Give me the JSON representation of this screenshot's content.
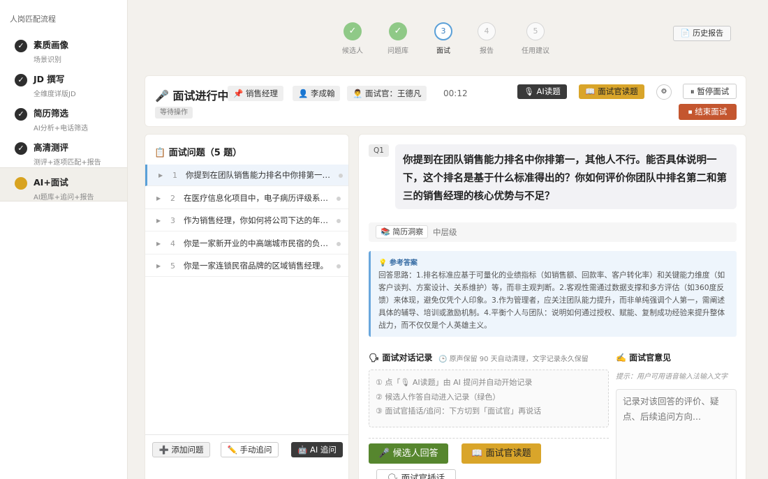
{
  "sidebar": {
    "title": "人岗匹配流程",
    "steps": [
      {
        "title": "素质画像",
        "sub": "场景识别",
        "icon": "check-icon"
      },
      {
        "title": "JD 撰写",
        "sub": "全维度详版JD",
        "icon": "check-icon"
      },
      {
        "title": "简历筛选",
        "sub": "AI分析+电话筛选",
        "icon": "check-icon"
      },
      {
        "title": "高清测评",
        "sub": "测评+逐项匹配+报告",
        "icon": "check-icon"
      },
      {
        "title": "AI+面试",
        "sub": "AI题库+追问+报告",
        "icon": "active-dot"
      }
    ]
  },
  "progress": {
    "steps": [
      {
        "label": "候选人",
        "mark": "✓",
        "state": "done"
      },
      {
        "label": "问题库",
        "mark": "✓",
        "state": "done"
      },
      {
        "label": "面试",
        "mark": "3",
        "state": "current"
      },
      {
        "label": "报告",
        "mark": "4",
        "state": "todo"
      },
      {
        "label": "任用建议",
        "mark": "5",
        "state": "todo"
      }
    ],
    "history_button": "📄 历史报告"
  },
  "header": {
    "title": "🎤 面试进行中",
    "position_tag": "📌 销售经理",
    "candidate_tag": "👤 李成翰",
    "interviewer_tag": "👨‍💼 面试官：王德凡",
    "timer": "00:12",
    "status": "等待操作",
    "ai_read_button": "🎙 AI读题",
    "interviewer_read_button": "📖 面试官读题",
    "settings_icon": "gear-icon",
    "pause_button": "⏸ 暂停面试",
    "end_button": "⏹ 结束面试"
  },
  "question_list": {
    "title": "📋 面试问题（5 题）",
    "items": [
      {
        "num": "1",
        "text": "你提到在团队销售能力排名中你排第一，其他人不行。"
      },
      {
        "num": "2",
        "text": "在医疗信息化项目中，电子病历评级系统的客户是谁？"
      },
      {
        "num": "3",
        "text": "作为销售经理，你如何将公司下达的年度目标分解？"
      },
      {
        "num": "4",
        "text": "你是一家新开业的中高端城市民宿的负责人。"
      },
      {
        "num": "5",
        "text": "你是一家连锁民宿品牌的区域销售经理。"
      }
    ],
    "add_button": "➕ 添加问题",
    "manual_button": "✏️ 手动追问",
    "ai_button": "🤖 AI 追问"
  },
  "question": {
    "badge": "Q1",
    "text": "你提到在团队销售能力排名中你排第一，其他人不行。能否具体说明一下，这个排名是基于什么标准得出的？你如何评价你团队中排名第二和第三的销售经理的核心优势与不足？",
    "source_tag": "📚 简历洞察",
    "level": "中层级"
  },
  "reference": {
    "title": "💡 参考答案",
    "body": "回答思路：1.排名标准应基于可量化的业绩指标（如销售额、回款率、客户转化率）和关键能力维度（如客户谈判、方案设计、关系维护）等，而非主观判断。2.客观性需通过数据支撑和多方评估（如360度反馈）来体现，避免仅凭个人印象。3.作为管理者，应关注团队能力提升，而非单纯强调个人第一，需阐述具体的辅导、培训或激励机制。4.平衡个人与团队：说明如何通过授权、赋能、复制成功经验来提升整体战力，而不仅仅是个人英雄主义。"
  },
  "conversation": {
    "title": "🗣 面试对话记录",
    "note": "🕒 原声保留 90 天自动清理，文字记录永久保留",
    "lines": [
      "① 点「🎙 AI读题」由 AI 提问并自动开始记录",
      "② 候选人作答自动进入记录（绿色）",
      "③ 面试官插话/追问：下方切到「面试官」再说话"
    ],
    "candidate_button": "🎤 候选人回答",
    "interviewer_read_button": "📖 面试官读题",
    "interviewer_talk_button": "🗣 面试官插话"
  },
  "opinion": {
    "title": "✍️ 面试官意见",
    "hint": "提示：用户可用语音输入法输入文字",
    "placeholder": "记录对该回答的评价、疑点、后续追问方向..."
  },
  "colors": {
    "accent_gold": "#d9a52a",
    "green": "#56862e",
    "red": "#c4562f",
    "blue": "#5aa0d8"
  }
}
